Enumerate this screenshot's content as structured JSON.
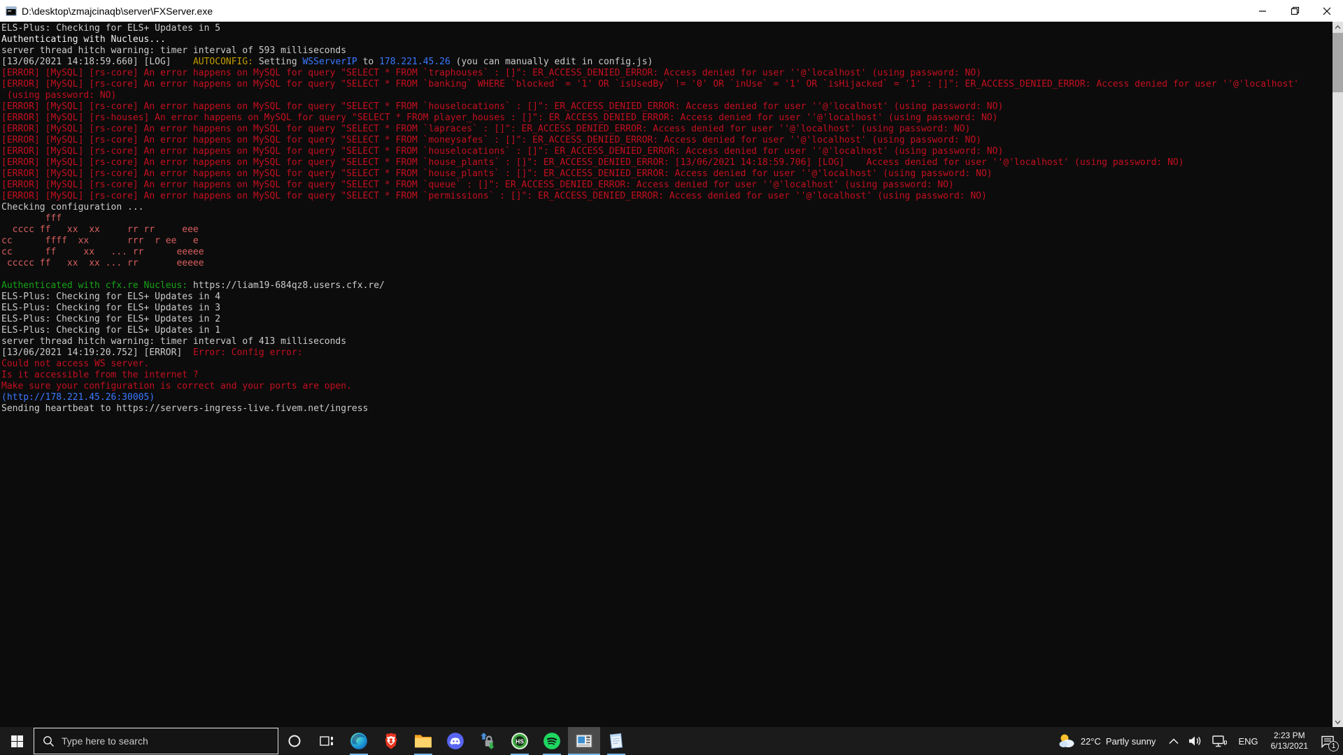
{
  "window": {
    "title": "D:\\desktop\\zmajcinaqb\\server\\FXServer.exe"
  },
  "console": {
    "palette": {
      "white": "#cccccc",
      "brightWhite": "#f2f2f2",
      "red": "#c50f1f",
      "artRed": "#d95f5f",
      "green": "#16a316",
      "yellow": "#c19c00",
      "blue": "#3b78ff"
    },
    "lines": [
      {
        "s": [
          {
            "t": "ELS-Plus: Checking for ELS+ Updates in 5",
            "c": "white"
          }
        ]
      },
      {
        "s": [
          {
            "t": "Authenticating with Nucleus...",
            "c": "brightWhite"
          }
        ]
      },
      {
        "s": [
          {
            "t": "server thread hitch warning: timer interval of 593 milliseconds",
            "c": "white"
          }
        ]
      },
      {
        "s": [
          {
            "t": "[13/06/2021 14:18:59.660] [LOG]    ",
            "c": "white"
          },
          {
            "t": "AUTOCONFIG: ",
            "c": "yellow"
          },
          {
            "t": "Setting ",
            "c": "white"
          },
          {
            "t": "WSServerIP",
            "c": "blue"
          },
          {
            "t": " to ",
            "c": "white"
          },
          {
            "t": "178.221.45.26",
            "c": "blue"
          },
          {
            "t": " (you can manually edit in config.js)",
            "c": "white"
          }
        ]
      },
      {
        "s": [
          {
            "t": "[ERROR] [MySQL] [rs-core] An error happens on MySQL for query \"SELECT * FROM `traphouses` : []\": ER_ACCESS_DENIED_ERROR: Access denied for user ''@'localhost' (using password: NO)",
            "c": "red"
          }
        ]
      },
      {
        "s": [
          {
            "t": "[ERROR] [MySQL] [rs-core] An error happens on MySQL for query \"SELECT * FROM `banking` WHERE `blocked` = '1' OR `isUsedBy` != '0' OR `inUse` = '1' OR `isHijacked` = '1' : []\": ER_ACCESS_DENIED_ERROR: Access denied for user ''@'localhost'",
            "c": "red"
          }
        ]
      },
      {
        "s": [
          {
            "t": " (using password: NO)",
            "c": "red"
          }
        ]
      },
      {
        "s": [
          {
            "t": "[ERROR] [MySQL] [rs-core] An error happens on MySQL for query \"SELECT * FROM `houselocations` : []\": ER_ACCESS_DENIED_ERROR: Access denied for user ''@'localhost' (using password: NO)",
            "c": "red"
          }
        ]
      },
      {
        "s": [
          {
            "t": "[ERROR] [MySQL] [rs-houses] An error happens on MySQL for query \"SELECT * FROM player_houses : []\": ER_ACCESS_DENIED_ERROR: Access denied for user ''@'localhost' (using password: NO)",
            "c": "red"
          }
        ]
      },
      {
        "s": [
          {
            "t": "[ERROR] [MySQL] [rs-core] An error happens on MySQL for query \"SELECT * FROM `lapraces` : []\": ER_ACCESS_DENIED_ERROR: Access denied for user ''@'localhost' (using password: NO)",
            "c": "red"
          }
        ]
      },
      {
        "s": [
          {
            "t": "[ERROR] [MySQL] [rs-core] An error happens on MySQL for query \"SELECT * FROM `moneysafes` : []\": ER_ACCESS_DENIED_ERROR: Access denied for user ''@'localhost' (using password: NO)",
            "c": "red"
          }
        ]
      },
      {
        "s": [
          {
            "t": "[ERROR] [MySQL] [rs-core] An error happens on MySQL for query \"SELECT * FROM `houselocations` : []\": ER_ACCESS_DENIED_ERROR: Access denied for user ''@'localhost' (using password: NO)",
            "c": "red"
          }
        ]
      },
      {
        "s": [
          {
            "t": "[ERROR] [MySQL] [rs-core] An error happens on MySQL for query \"SELECT * FROM `house_plants` : []\": ER_ACCESS_DENIED_ERROR: [13/06/2021 14:18:59.706] [LOG]    Access denied for user ''@'localhost' (using password: NO)",
            "c": "red"
          }
        ]
      },
      {
        "s": [
          {
            "t": "[ERROR] [MySQL] [rs-core] An error happens on MySQL for query \"SELECT * FROM `house_plants` : []\": ER_ACCESS_DENIED_ERROR: Access denied for user ''@'localhost' (using password: NO)",
            "c": "red"
          }
        ]
      },
      {
        "s": [
          {
            "t": "[ERROR] [MySQL] [rs-core] An error happens on MySQL for query \"SELECT * FROM `queue` : []\": ER_ACCESS_DENIED_ERROR: Access denied for user ''@'localhost' (using password: NO)",
            "c": "red"
          }
        ]
      },
      {
        "s": [
          {
            "t": "[ERROR] [MySQL] [rs-core] An error happens on MySQL for query \"SELECT * FROM `permissions` : []\": ER_ACCESS_DENIED_ERROR: Access denied for user ''@'localhost' (using password: NO)",
            "c": "red"
          }
        ]
      },
      {
        "s": [
          {
            "t": "Checking configuration ...",
            "c": "white"
          }
        ]
      },
      {
        "s": [
          {
            "t": "        fff",
            "c": "artRed"
          }
        ]
      },
      {
        "s": [
          {
            "t": "  cccc ff   xx  xx     rr rr     eee",
            "c": "artRed"
          }
        ]
      },
      {
        "s": [
          {
            "t": "cc      ffff  xx       rrr  r ee   e",
            "c": "artRed"
          }
        ]
      },
      {
        "s": [
          {
            "t": "cc      ff     xx   ... rr      eeeee",
            "c": "artRed"
          }
        ]
      },
      {
        "s": [
          {
            "t": " ccccc ff   xx  xx ... rr       eeeee",
            "c": "artRed"
          }
        ]
      },
      {
        "s": []
      },
      {
        "s": [
          {
            "t": "Authenticated with cfx.re Nucleus: ",
            "c": "green"
          },
          {
            "t": "https://liam19-684qz8.users.cfx.re/",
            "c": "white"
          }
        ]
      },
      {
        "s": [
          {
            "t": "ELS-Plus: Checking for ELS+ Updates in 4",
            "c": "white"
          }
        ]
      },
      {
        "s": [
          {
            "t": "ELS-Plus: Checking for ELS+ Updates in 3",
            "c": "white"
          }
        ]
      },
      {
        "s": [
          {
            "t": "ELS-Plus: Checking for ELS+ Updates in 2",
            "c": "white"
          }
        ]
      },
      {
        "s": [
          {
            "t": "ELS-Plus: Checking for ELS+ Updates in 1",
            "c": "white"
          }
        ]
      },
      {
        "s": [
          {
            "t": "server thread hitch warning: timer interval of 413 milliseconds",
            "c": "white"
          }
        ]
      },
      {
        "s": [
          {
            "t": "[13/06/2021 14:19:20.752] [ERROR]  ",
            "c": "white"
          },
          {
            "t": "Error: Config error:",
            "c": "red"
          }
        ]
      },
      {
        "s": [
          {
            "t": "Could not access WS server.",
            "c": "red"
          }
        ]
      },
      {
        "s": [
          {
            "t": "Is it accessible from the internet ?",
            "c": "red"
          }
        ]
      },
      {
        "s": [
          {
            "t": "Make sure your configuration is correct and your ports are open.",
            "c": "red"
          }
        ]
      },
      {
        "s": [
          {
            "t": "(http://178.221.45.26:30005)",
            "c": "blue"
          }
        ]
      },
      {
        "s": [
          {
            "t": "Sending heartbeat to https://servers-ingress-live.fivem.net/ingress",
            "c": "white"
          }
        ]
      }
    ]
  },
  "taskbar": {
    "search_placeholder": "Type here to search",
    "hs_badge": "HS",
    "apps": [
      "edge",
      "brave",
      "file-explorer",
      "discord",
      "secure-transfer",
      "hs-app",
      "spotify",
      "fxserver-console",
      "notepad"
    ],
    "tray": {
      "temp": "22°C",
      "condition": "Partly sunny",
      "lang": "ENG",
      "time": "2:23 PM",
      "date": "6/13/2021",
      "badge": "1"
    }
  }
}
